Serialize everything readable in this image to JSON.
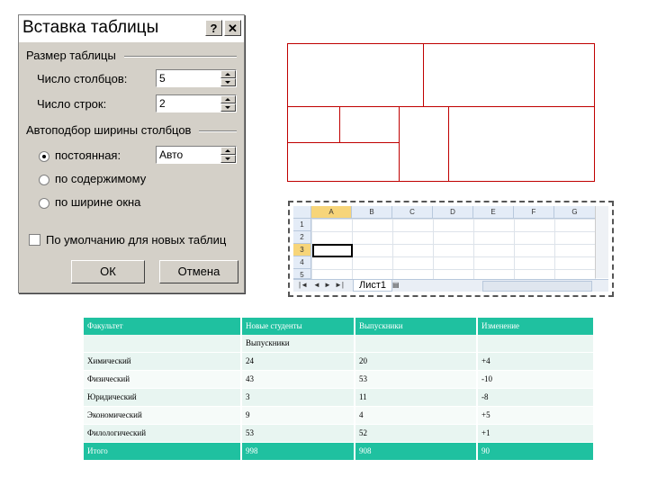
{
  "dialog": {
    "title": "Вставка таблицы",
    "help_btn": "?",
    "close_btn": "✕",
    "group_size": "Размер таблицы",
    "cols_label": "Число столбцов:",
    "cols_value": "5",
    "rows_label": "Число строк:",
    "rows_value": "2",
    "group_autofit": "Автоподбор ширины столбцов",
    "radio_fixed": "постоянная:",
    "fixed_value": "Авто",
    "radio_content": "по содержимому",
    "radio_window": "по ширине окна",
    "default_check": "По умолчанию для новых таблиц",
    "ok": "ОК",
    "cancel": "Отмена"
  },
  "excel": {
    "columns": [
      "A",
      "B",
      "C",
      "D",
      "E",
      "F",
      "G"
    ],
    "rows": [
      "1",
      "2",
      "3",
      "4",
      "5"
    ],
    "selected_cell": "A3",
    "sheet_tab": "Лист1"
  },
  "table": {
    "header": [
      "Факультет",
      "Новые студенты",
      "Выпускники",
      "Изменение"
    ],
    "subheader": [
      "",
      "Выпускники",
      "",
      ""
    ],
    "rows": [
      [
        "Химический",
        "24",
        "20",
        "+4"
      ],
      [
        "Физический",
        "43",
        "53",
        "-10"
      ],
      [
        "Юридический",
        "3",
        "11",
        "-8"
      ],
      [
        "Экономический",
        "9",
        "4",
        "+5"
      ],
      [
        "Филологический",
        "53",
        "52",
        "+1"
      ]
    ],
    "total": [
      "Итого",
      "998",
      "908",
      "90"
    ]
  },
  "colors": {
    "dialog_bg": "#d4d0c8",
    "table_accent": "#1fc1a0",
    "drawing_line": "#c00000"
  }
}
